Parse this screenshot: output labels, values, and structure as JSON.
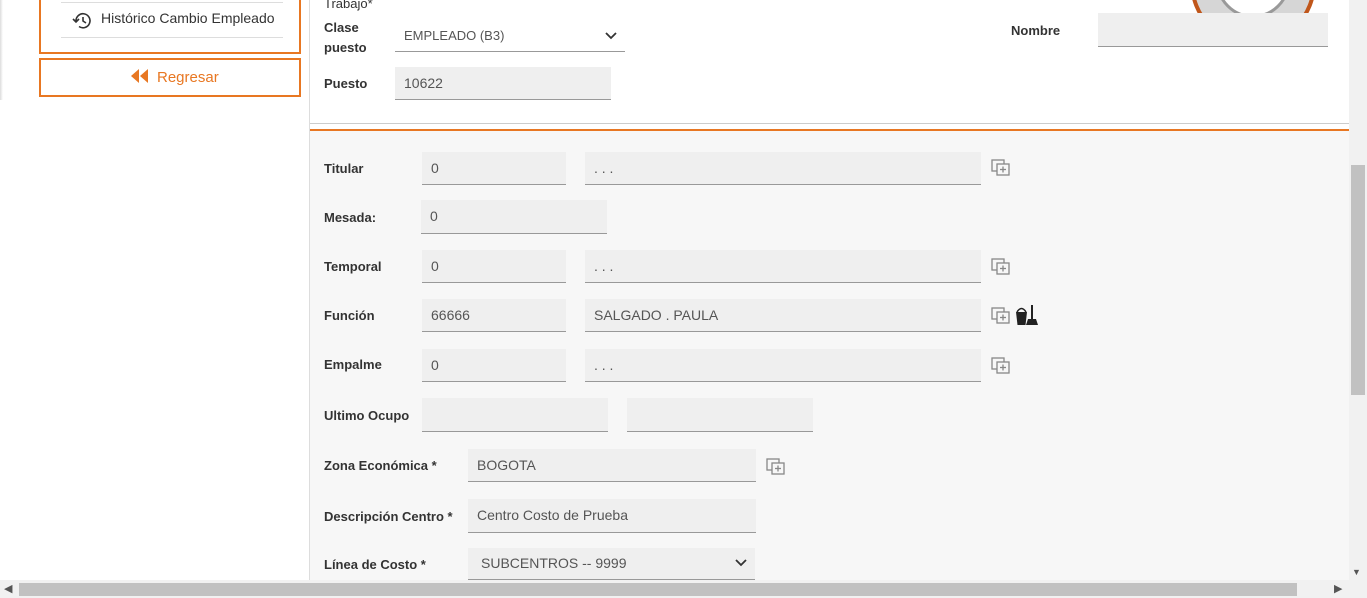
{
  "sidebar": {
    "history_label": "Histórico Cambio Empleado",
    "back_label": "Regresar"
  },
  "top": {
    "trabajo_label": "Trabajo*",
    "clase_puesto_label_1": "Clase",
    "clase_puesto_label_2": "puesto",
    "clase_puesto_value": "EMPLEADO (B3)",
    "puesto_label": "Puesto",
    "puesto_value": "10622",
    "nombre_label": "Nombre",
    "nombre_value": ""
  },
  "form": {
    "titular": {
      "label": "Titular",
      "code": "0",
      "name": ". . ."
    },
    "mesada": {
      "label": "Mesada:",
      "value": "0"
    },
    "temporal": {
      "label": "Temporal",
      "code": "0",
      "name": ". . ."
    },
    "funcion": {
      "label": "Función",
      "code": "66666",
      "name": "SALGADO . PAULA"
    },
    "empalme": {
      "label": "Empalme",
      "code": "0",
      "name": ". . ."
    },
    "ultimo_ocupo": {
      "label": "Ultimo Ocupo",
      "value1": "",
      "value2": ""
    },
    "zona": {
      "label": "Zona Económica *",
      "value": "BOGOTA"
    },
    "descripcion": {
      "label": "Descripción Centro *",
      "value": "Centro Costo de Prueba"
    },
    "linea": {
      "label": "Línea de Costo *",
      "value": "SUBCENTROS -- 9999"
    }
  },
  "colors": {
    "accent": "#e87722",
    "field_bg": "#efefef"
  },
  "icons": {
    "history": "history-icon",
    "back": "double-chevron-left-icon",
    "lookup": "lookup-add-icon",
    "clear": "broom-bucket-icon",
    "dropdown": "chevron-down-icon"
  }
}
